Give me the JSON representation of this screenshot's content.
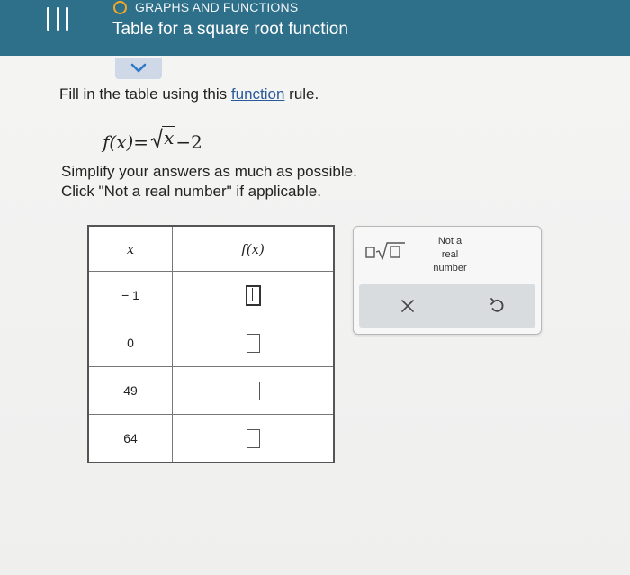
{
  "header": {
    "topic": "GRAPHS AND FUNCTIONS",
    "title": "Table for a square root function"
  },
  "instructions": {
    "prefix": "Fill in the table using this ",
    "link": "function",
    "suffix": " rule.",
    "simplify": "Simplify your answers as much as possible.",
    "not_real_hint": "Click \"Not a real number\" if applicable."
  },
  "formula": {
    "lhs": "f(x)",
    "equals": "=",
    "radicand": "x",
    "tail": "−2"
  },
  "table": {
    "headers": [
      "x",
      "f(x)"
    ],
    "rows": [
      {
        "x": "− 1",
        "fx": ""
      },
      {
        "x": "0",
        "fx": ""
      },
      {
        "x": "49",
        "fx": ""
      },
      {
        "x": "64",
        "fx": ""
      }
    ]
  },
  "keypad": {
    "not_real_lines": [
      "Not a",
      "real",
      "number"
    ]
  },
  "colors": {
    "header_bg": "#2e6f8a",
    "topic_icon": "#f4a825",
    "link": "#2a5a9a"
  }
}
